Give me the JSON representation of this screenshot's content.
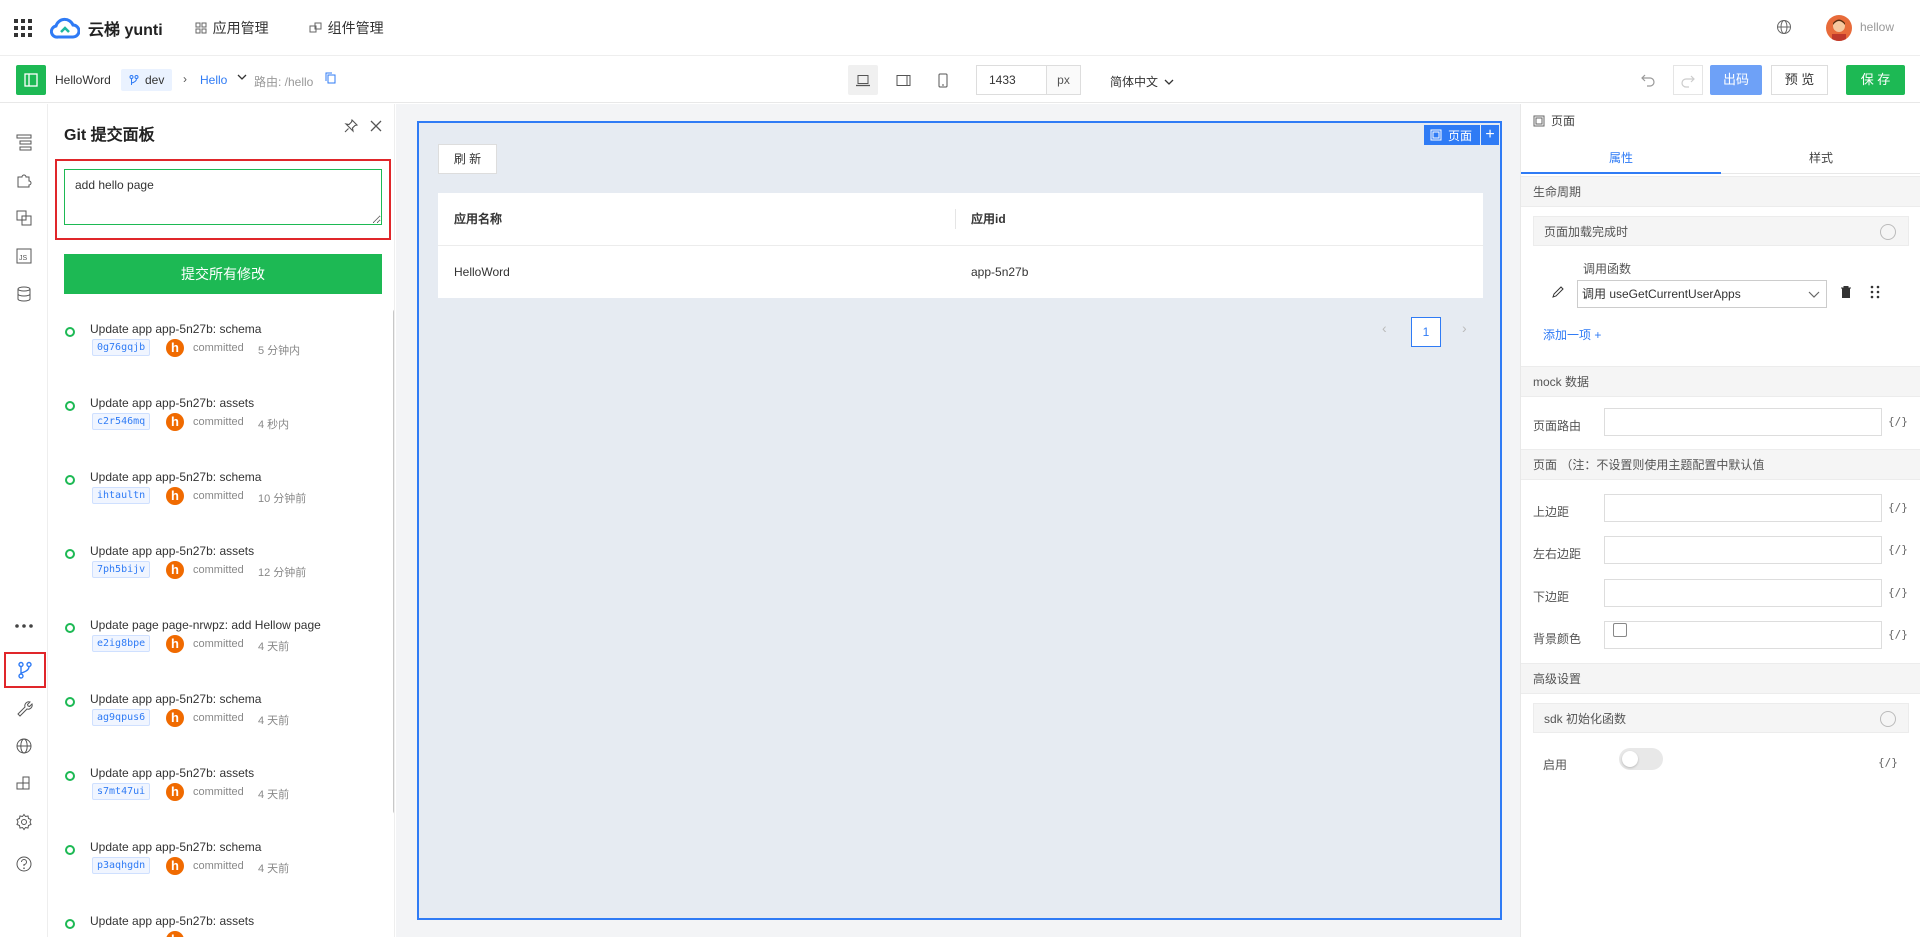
{
  "topbar": {
    "brand": "云梯 yunti",
    "nav": [
      {
        "label": "应用管理"
      },
      {
        "label": "组件管理"
      }
    ],
    "username": "hellow"
  },
  "toolbar": {
    "app_name": "HelloWord",
    "branch": "dev",
    "page_name": "Hello",
    "route": "路由: /hello",
    "width_value": "1433",
    "width_unit": "px",
    "language": "简体中文",
    "code_label": "出码",
    "preview_label": "预 览",
    "save_label": "保 存"
  },
  "git_panel": {
    "title": "Git 提交面板",
    "commit_message": "add hello page",
    "commit_button": "提交所有修改",
    "commits": [
      {
        "message": "Update app app-5n27b: schema",
        "hash": "0g76gqjb",
        "avatar": "h",
        "action": "committed",
        "time": "5 分钟内"
      },
      {
        "message": "Update app app-5n27b: assets",
        "hash": "c2r546mq",
        "avatar": "h",
        "action": "committed",
        "time": "4 秒内"
      },
      {
        "message": "Update app app-5n27b: schema",
        "hash": "ihtaultn",
        "avatar": "h",
        "action": "committed",
        "time": "10 分钟前"
      },
      {
        "message": "Update app app-5n27b: assets",
        "hash": "7ph5bijv",
        "avatar": "h",
        "action": "committed",
        "time": "12 分钟前"
      },
      {
        "message": "Update page page-nrwpz: add Hellow page",
        "hash": "e2ig8bpe",
        "avatar": "h",
        "action": "committed",
        "time": "4 天前"
      },
      {
        "message": "Update app app-5n27b: schema",
        "hash": "ag9qpus6",
        "avatar": "h",
        "action": "committed",
        "time": "4 天前"
      },
      {
        "message": "Update app app-5n27b: assets",
        "hash": "s7mt47ui",
        "avatar": "h",
        "action": "committed",
        "time": "4 天前"
      },
      {
        "message": "Update app app-5n27b: schema",
        "hash": "p3aqhgdn",
        "avatar": "h",
        "action": "committed",
        "time": "4 天前"
      },
      {
        "message": "Update app app-5n27b: assets",
        "hash": "",
        "avatar": "h",
        "action": "",
        "time": ""
      }
    ]
  },
  "canvas": {
    "page_tag": "页面",
    "plus": "+",
    "refresh_label": "刷 新",
    "table": {
      "columns": [
        "应用名称",
        "应用id"
      ],
      "rows": [
        [
          "HelloWord",
          "app-5n27b"
        ]
      ]
    },
    "pagination": {
      "prev": "‹",
      "current": "1",
      "next": "›"
    }
  },
  "props": {
    "header": "页面",
    "tabs": [
      "属性",
      "样式"
    ],
    "lifecycle": {
      "section": "生命周期",
      "hook": "页面加载完成时",
      "call_label": "调用函数",
      "call_value": "调用 useGetCurrentUserApps",
      "add_item": "添加一项 +"
    },
    "mock": {
      "section": "mock 数据",
      "route_label": "页面路由"
    },
    "page_section": "页面 （注：不设置则使用主题配置中默认值",
    "fields": [
      {
        "label": "上边距"
      },
      {
        "label": "左右边距"
      },
      {
        "label": "下边距"
      },
      {
        "label": "背景颜色"
      }
    ],
    "advanced": {
      "section": "高级设置",
      "sdk": "sdk 初始化函数",
      "enable_label": "启用"
    },
    "code_toggle": "{/}"
  },
  "colors": {
    "brand_green": "#1db954",
    "accent_blue": "#2f7bf5",
    "highlight_red": "#e0262a"
  }
}
